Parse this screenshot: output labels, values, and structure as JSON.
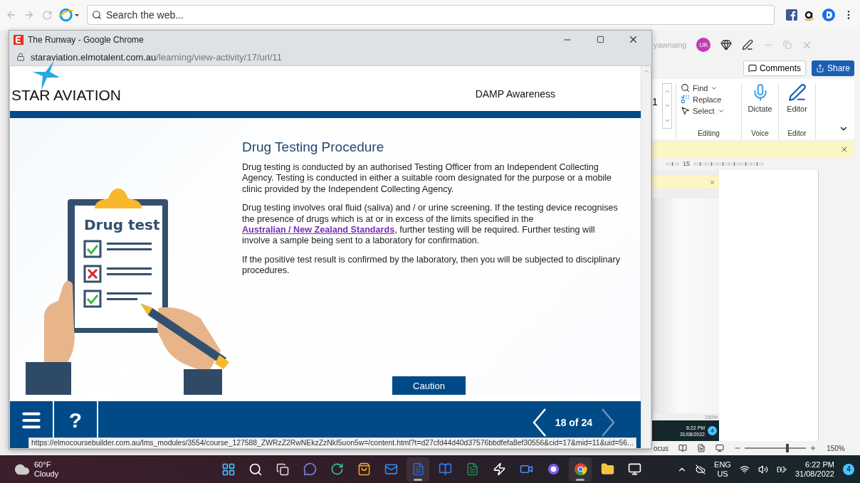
{
  "browser": {
    "search": {
      "placeholder": "Search the web..."
    }
  },
  "popup": {
    "title": "The Runway - Google Chrome",
    "url_host": "staraviation.elmotalent.com.au",
    "url_path": "/learning/view-activity/17/url/11",
    "course": {
      "logo": "STAR AVIATION",
      "module_title": "DAMP Awareness",
      "heading": "Drug Testing Procedure",
      "paragraphs": [
        {
          "parts": [
            {
              "text": "Drug testing is conducted by an authorised Testing Officer from an Independent Collecting Agency. Testing is conducted in either a suitable room designated for the purpose or a mobile clinic provided by the Independent Collecting Agency.",
              "link": false
            }
          ]
        },
        {
          "parts": [
            {
              "text": "Drug testing involves oral fluid (saliva) and / or urine screening. If the testing device recognises the presence of drugs which is at or in excess of the limits specified in the ",
              "link": false
            },
            {
              "text": "Australian / New Zealand Standards",
              "link": true
            },
            {
              "text": ", further testing will be required. Further testing will involve a sample being sent to a laboratory for confirmation.",
              "link": false
            }
          ]
        },
        {
          "parts": [
            {
              "text": "If the positive test result is confirmed by the laboratory, then you will be subjected to disciplinary procedures.",
              "link": false
            }
          ]
        }
      ],
      "illustration": {
        "title": "Drug test",
        "checklist": [
          {
            "kind": "tick"
          },
          {
            "kind": "cross"
          },
          {
            "kind": "tick"
          }
        ]
      },
      "caution_button": "Caution",
      "nav": {
        "help": "?",
        "page": "18 of 24"
      }
    },
    "status_url": "https://elmocoursebuilder.com.au/lms_modules/3554/course_127588_ZWRzZ2RwNEkzZzNkI5uon5w=/content.html?t=d27cfd44d40d37576bbdfefa8ef30556&cid=17&mid=11&uid=56..."
  },
  "word": {
    "user": "yawnaing",
    "avatar": "UK",
    "comments": "Comments",
    "share": "Share",
    "font_size": "1",
    "editing": [
      {
        "label": "Find",
        "dropdown": true,
        "kind": "find"
      },
      {
        "label": "Replace",
        "dropdown": false,
        "kind": "replace"
      },
      {
        "label": "Select",
        "dropdown": true,
        "kind": "select"
      }
    ],
    "groups": [
      {
        "kind": "editing",
        "label": "Editing"
      },
      {
        "kind": "voice",
        "label": "Voice",
        "button": "Dictate"
      },
      {
        "kind": "editor",
        "label": "Editor",
        "button": "Editor"
      }
    ],
    "ruler": "15",
    "thumbnail": {
      "zoom": "150%",
      "time": "6:22 PM",
      "date": "31/08/2022",
      "badge": "4"
    },
    "status": {
      "focus": "ocus",
      "zoom": "150%",
      "level": 0.7
    }
  },
  "taskbar": {
    "weather": {
      "temp": "60°F",
      "condition": "Cloudy"
    },
    "apps": [
      {
        "kind": "start",
        "active": false
      },
      {
        "kind": "search",
        "active": false
      },
      {
        "kind": "taskview",
        "active": false
      },
      {
        "kind": "chat",
        "active": false
      },
      {
        "kind": "edge",
        "active": false
      },
      {
        "kind": "store",
        "active": false
      },
      {
        "kind": "mail",
        "active": false
      },
      {
        "kind": "word",
        "active": true
      },
      {
        "kind": "dropbox",
        "active": false
      },
      {
        "kind": "excel",
        "active": false
      },
      {
        "kind": "bolt",
        "active": false
      },
      {
        "kind": "video",
        "active": false
      },
      {
        "kind": "ring",
        "active": false
      },
      {
        "kind": "chrome",
        "active": true
      },
      {
        "kind": "folder",
        "active": false
      },
      {
        "kind": "remote",
        "active": false
      }
    ],
    "language": "ENG",
    "region": "US",
    "time": "6:22 PM",
    "date": "31/08/2022",
    "notifications": "4"
  }
}
